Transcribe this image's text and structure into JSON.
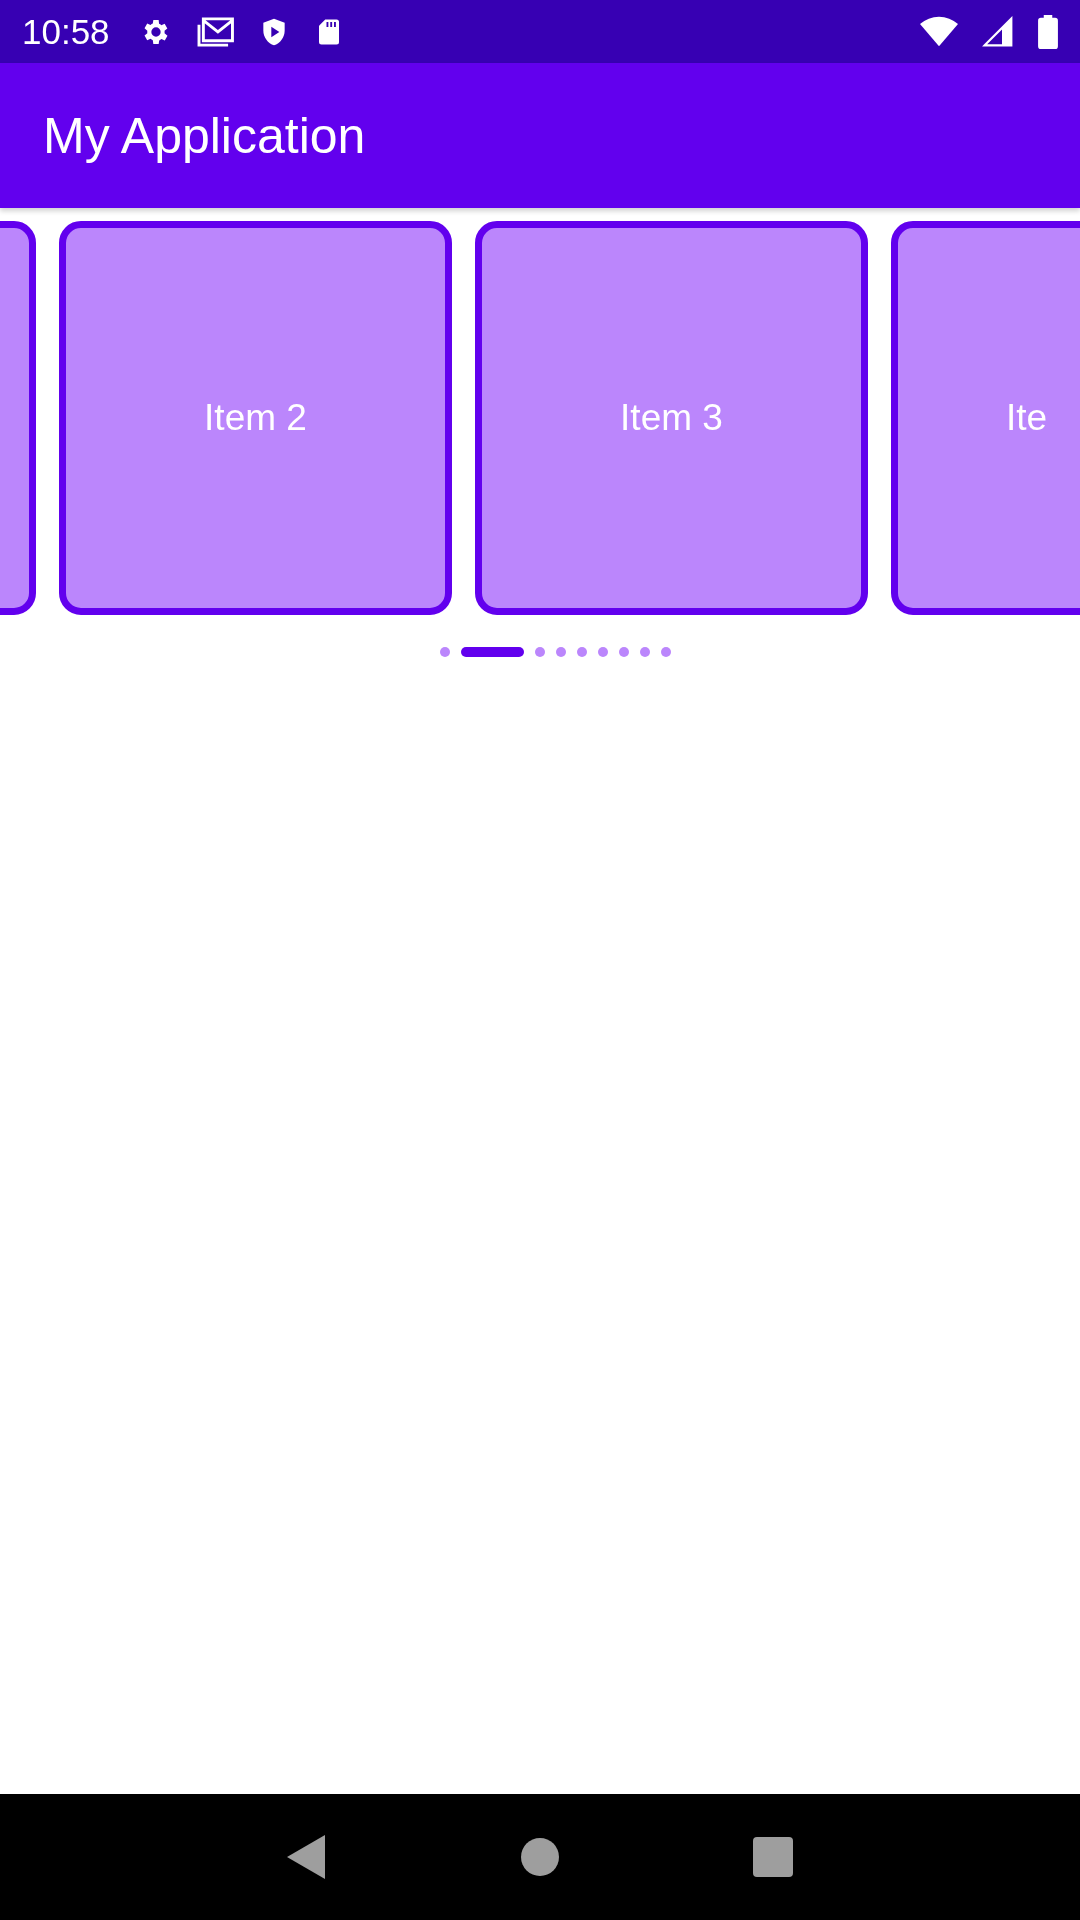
{
  "status_bar": {
    "time": "10:58"
  },
  "app_bar": {
    "title": "My Application"
  },
  "carousel": {
    "leading_partial_card": true,
    "cards": [
      {
        "label": "Item 2"
      },
      {
        "label": "Item 3"
      },
      {
        "label": "Ite",
        "clipped": true
      }
    ]
  },
  "page_indicator": [
    {
      "selected": false
    },
    {
      "selected": true
    },
    {
      "selected": false
    },
    {
      "selected": false
    },
    {
      "selected": false
    },
    {
      "selected": false
    },
    {
      "selected": false
    },
    {
      "selected": false
    },
    {
      "selected": false
    }
  ]
}
